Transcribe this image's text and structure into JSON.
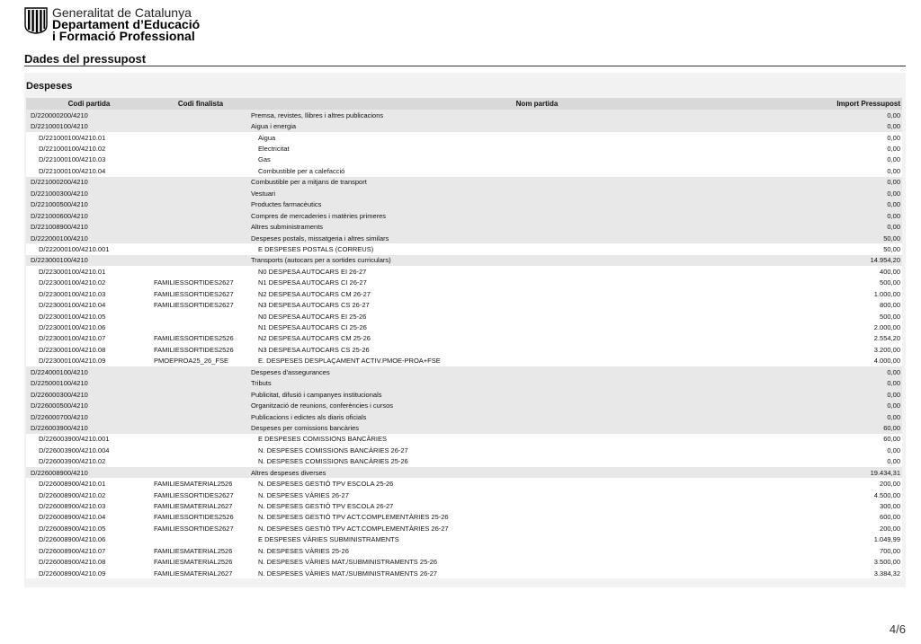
{
  "header": {
    "org_line1": "Generalitat de Catalunya",
    "org_line2": "Departament d’Educació",
    "org_line3": "i Formació Professional",
    "logo_icon": "generalitat-coat-of-arms-icon"
  },
  "document_title": "Dades del pressupost",
  "section": {
    "title": "Despeses",
    "columns": [
      "Codi partida",
      "Codi finalista",
      "Nom partida",
      "Import Pressupost"
    ],
    "rows": [
      {
        "level": "parent",
        "code": "D/220000200/4210",
        "finalist": "",
        "name": "Premsa, revistes, llibres i altres publicacions",
        "amount": "0,00"
      },
      {
        "level": "parent",
        "code": "D/221000100/4210",
        "finalist": "",
        "name": "Aigua i energia",
        "amount": "0,00"
      },
      {
        "level": "child",
        "code": "D/221000100/4210.01",
        "finalist": "",
        "name": "Aigua",
        "amount": "0,00"
      },
      {
        "level": "child",
        "code": "D/221000100/4210.02",
        "finalist": "",
        "name": "Electricitat",
        "amount": "0,00"
      },
      {
        "level": "child",
        "code": "D/221000100/4210.03",
        "finalist": "",
        "name": "Gas",
        "amount": "0,00"
      },
      {
        "level": "child",
        "code": "D/221000100/4210.04",
        "finalist": "",
        "name": "Combustible per a calefacció",
        "amount": "0,00"
      },
      {
        "level": "parent",
        "code": "D/221000200/4210",
        "finalist": "",
        "name": "Combustible per a mitjans de transport",
        "amount": "0,00"
      },
      {
        "level": "parent",
        "code": "D/221000300/4210",
        "finalist": "",
        "name": "Vestuari",
        "amount": "0,00"
      },
      {
        "level": "parent",
        "code": "D/221000500/4210",
        "finalist": "",
        "name": "Productes farmacèutics",
        "amount": "0,00"
      },
      {
        "level": "parent",
        "code": "D/221000600/4210",
        "finalist": "",
        "name": "Compres de mercaderies i matèries primeres",
        "amount": "0,00"
      },
      {
        "level": "parent",
        "code": "D/221008900/4210",
        "finalist": "",
        "name": "Altres subministraments",
        "amount": "0,00"
      },
      {
        "level": "parent",
        "code": "D/222000100/4210",
        "finalist": "",
        "name": "Despeses postals, missatgeria i altres similars",
        "amount": "50,00"
      },
      {
        "level": "child",
        "code": "D/222000100/4210.001",
        "finalist": "",
        "name": "E DESPESES POSTALS (CORREUS)",
        "amount": "50,00"
      },
      {
        "level": "parent",
        "code": "D/223000100/4210",
        "finalist": "",
        "name": "Transports (autocars per a sortides curriculars)",
        "amount": "14.954,20"
      },
      {
        "level": "child",
        "code": "D/223000100/4210.01",
        "finalist": "",
        "name": "N0 DESPESA AUTOCARS  EI 26-27",
        "amount": "400,00"
      },
      {
        "level": "child",
        "code": "D/223000100/4210.02",
        "finalist": "FAMILIESSORTIDES2627",
        "name": "N1 DESPESA AUTOCARS CI 26-27",
        "amount": "500,00"
      },
      {
        "level": "child",
        "code": "D/223000100/4210.03",
        "finalist": "FAMILIESSORTIDES2627",
        "name": "N2 DESPESA AUTOCARS CM 26-27",
        "amount": "1.000,00"
      },
      {
        "level": "child",
        "code": "D/223000100/4210.04",
        "finalist": "FAMILIESSORTIDES2627",
        "name": "N3 DESPESA AUTOCARS CS 26-27",
        "amount": "800,00"
      },
      {
        "level": "child",
        "code": "D/223000100/4210.05",
        "finalist": "",
        "name": "N0 DESPESA AUTOCARS  EI 25-26",
        "amount": "500,00"
      },
      {
        "level": "child",
        "code": "D/223000100/4210.06",
        "finalist": "",
        "name": "N1 DESPESA AUTOCARS CI 25-26",
        "amount": "2.000,00"
      },
      {
        "level": "child",
        "code": "D/223000100/4210.07",
        "finalist": "FAMILIESSORTIDES2526",
        "name": "N2 DESPESA AUTOCARS CM 25-26",
        "amount": "2.554,20"
      },
      {
        "level": "child",
        "code": "D/223000100/4210.08",
        "finalist": "FAMILIESSORTIDES2526",
        "name": "N3 DESPESA AUTOCARS CS 25-26",
        "amount": "3.200,00"
      },
      {
        "level": "child",
        "code": "D/223000100/4210.09",
        "finalist": "PMOEPROA25_26_FSE",
        "name": "E. DESPESES DESPLAÇAMENT ACTIV.PMOE-PROA+FSE",
        "amount": "4.000,00"
      },
      {
        "level": "parent",
        "code": "D/224000100/4210",
        "finalist": "",
        "name": "Despeses d'assegurances",
        "amount": "0,00"
      },
      {
        "level": "parent",
        "code": "D/225000100/4210",
        "finalist": "",
        "name": "Tributs",
        "amount": "0,00"
      },
      {
        "level": "parent",
        "code": "D/226000300/4210",
        "finalist": "",
        "name": "Publicitat, difusió i campanyes institucionals",
        "amount": "0,00"
      },
      {
        "level": "parent",
        "code": "D/226000500/4210",
        "finalist": "",
        "name": "Organització de reunions, conferències i cursos",
        "amount": "0,00"
      },
      {
        "level": "parent",
        "code": "D/226000700/4210",
        "finalist": "",
        "name": "Publicacions i edictes als diaris oficials",
        "amount": "0,00"
      },
      {
        "level": "parent",
        "code": "D/226003900/4210",
        "finalist": "",
        "name": "Despeses per comissions bancàries",
        "amount": "60,00"
      },
      {
        "level": "child",
        "code": "D/226003900/4210.001",
        "finalist": "",
        "name": "E DESPESES COMISSIONS BANCÀRIES",
        "amount": "60,00"
      },
      {
        "level": "child",
        "code": "D/226003900/4210.004",
        "finalist": "",
        "name": "N. DESPESES COMISSIONS BANCÀRIES 26-27",
        "amount": "0,00"
      },
      {
        "level": "child",
        "code": "D/226003900/4210.02",
        "finalist": "",
        "name": "N. DESPESES COMISSIONS BANCÀRIES 25-26",
        "amount": "0,00"
      },
      {
        "level": "parent",
        "code": "D/226008900/4210",
        "finalist": "",
        "name": "Altres despeses diverses",
        "amount": "19.434,31"
      },
      {
        "level": "child",
        "code": "D/226008900/4210.01",
        "finalist": "FAMILIESMATERIAL2526",
        "name": "N. DESPESES GESTIÓ TPV ESCOLA 25-26",
        "amount": "200,00"
      },
      {
        "level": "child",
        "code": "D/226008900/4210.02",
        "finalist": "FAMILIESSORTIDES2627",
        "name": "N. DESPESES VÀRIES  26-27",
        "amount": "4.500,00"
      },
      {
        "level": "child",
        "code": "D/226008900/4210.03",
        "finalist": "FAMILIESMATERIAL2627",
        "name": "N. DESPESES GESTIÓ TPV ESCOLA 26-27",
        "amount": "300,00"
      },
      {
        "level": "child",
        "code": "D/226008900/4210.04",
        "finalist": "FAMILIESSORTIDES2526",
        "name": "N. DESPESES GESTIÓ TPV ACT.COMPLEMENTÀRIES 25-26",
        "amount": "600,00"
      },
      {
        "level": "child",
        "code": "D/226008900/4210.05",
        "finalist": "FAMILIESSORTIDES2627",
        "name": "N. DESPESES GESTIÓ TPV ACT.COMPLEMENTÀRIES 26-27",
        "amount": "200,00"
      },
      {
        "level": "child",
        "code": "D/226008900/4210.06",
        "finalist": "",
        "name": "E DESPESES VÀRIES SUBMINISTRAMENTS",
        "amount": "1.049,99"
      },
      {
        "level": "child",
        "code": "D/226008900/4210.07",
        "finalist": "FAMILIESMATERIAL2526",
        "name": "N. DESPESES VÀRIES  25-26",
        "amount": "700,00"
      },
      {
        "level": "child",
        "code": "D/226008900/4210.08",
        "finalist": "FAMILIESMATERIAL2526",
        "name": "N. DESPESES VÀRIES MAT./SUBMINISTRAMENTS 25-26",
        "amount": "3.500,00"
      },
      {
        "level": "child",
        "code": "D/226008900/4210.09",
        "finalist": "FAMILIESMATERIAL2627",
        "name": "N. DESPESES VÀRIES MAT./SUBMINISTRAMENTS 26-27",
        "amount": "3.384,32"
      }
    ]
  },
  "page_indicator": "4/6"
}
